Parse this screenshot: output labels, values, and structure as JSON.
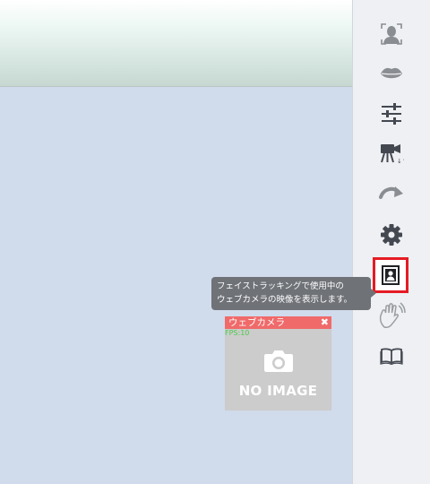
{
  "sidebar": {
    "items": [
      {
        "icon": "face-tracking-icon"
      },
      {
        "icon": "lips-icon"
      },
      {
        "icon": "sliders-icon"
      },
      {
        "icon": "video-camera-icon"
      },
      {
        "icon": "redo-arrow-icon"
      },
      {
        "icon": "gear-icon"
      },
      {
        "icon": "webcam-portrait-icon",
        "active": true
      },
      {
        "icon": "hand-wave-icon"
      },
      {
        "icon": "book-icon"
      }
    ]
  },
  "tooltip": {
    "line1": "フェイストラッキングで使用中の",
    "line2": "ウェブカメラの映像を表示します。"
  },
  "webcam_panel": {
    "title": "ウェブカメラ",
    "close_symbol": "✖",
    "fps_text": "FPS:10",
    "placeholder_text": "NO IMAGE"
  },
  "colors": {
    "active_border": "#e51b24",
    "webcam_header": "#f06a6a",
    "tooltip_bg": "#6f7277",
    "canvas_bg": "#d0dbec"
  }
}
